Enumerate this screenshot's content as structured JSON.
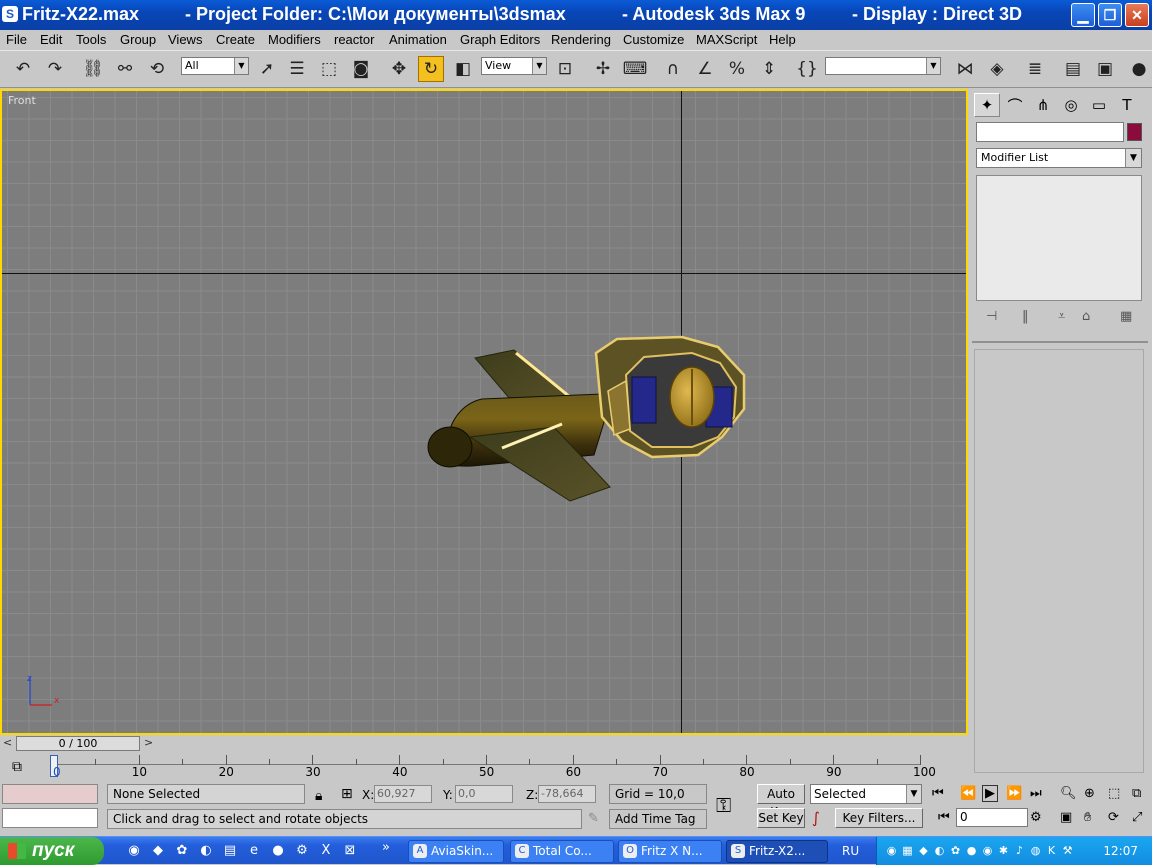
{
  "window": {
    "file": "Fritz-X22.max",
    "project": "- Project Folder: C:\\Мои документы\\3dsmax",
    "app": "- Autodesk 3ds Max 9",
    "display": "- Display : Direct 3D"
  },
  "menu": [
    "File",
    "Edit",
    "Tools",
    "Group",
    "Views",
    "Create",
    "Modifiers",
    "reactor",
    "Animation",
    "Graph Editors",
    "Rendering",
    "Customize",
    "MAXScript",
    "Help"
  ],
  "toolbar": {
    "selection_filter": "All",
    "ref_coord": "View"
  },
  "viewport": {
    "label": "Front",
    "axis_z": "z",
    "axis_x": "x"
  },
  "command_panel": {
    "modifier_list": "Modifier List",
    "object_color": "#8b0c3c"
  },
  "time_slider": {
    "value": "0 / 100"
  },
  "trackbar": {
    "labels": [
      "0",
      "10",
      "20",
      "30",
      "40",
      "50",
      "60",
      "70",
      "80",
      "90",
      "100"
    ]
  },
  "status": {
    "selection": "None Selected",
    "prompt": "Click and drag to select and rotate objects",
    "x_label": "X:",
    "x_value": "60,927",
    "y_label": "Y:",
    "y_value": "0,0",
    "z_label": "Z:",
    "z_value": "-78,664",
    "grid": "Grid = 10,0",
    "add_time_tag": "Add Time Tag",
    "auto_key": "Auto Key",
    "set_key": "Set Key",
    "key_mode": "Selected",
    "key_filters": "Key Filters...",
    "frame": "0"
  },
  "taskbar": {
    "start": "пуск",
    "tasks": [
      "AviaSkin...",
      "Total Co...",
      "Fritz X N...",
      "Fritz-X2..."
    ],
    "lang": "RU",
    "clock": "12:07"
  }
}
